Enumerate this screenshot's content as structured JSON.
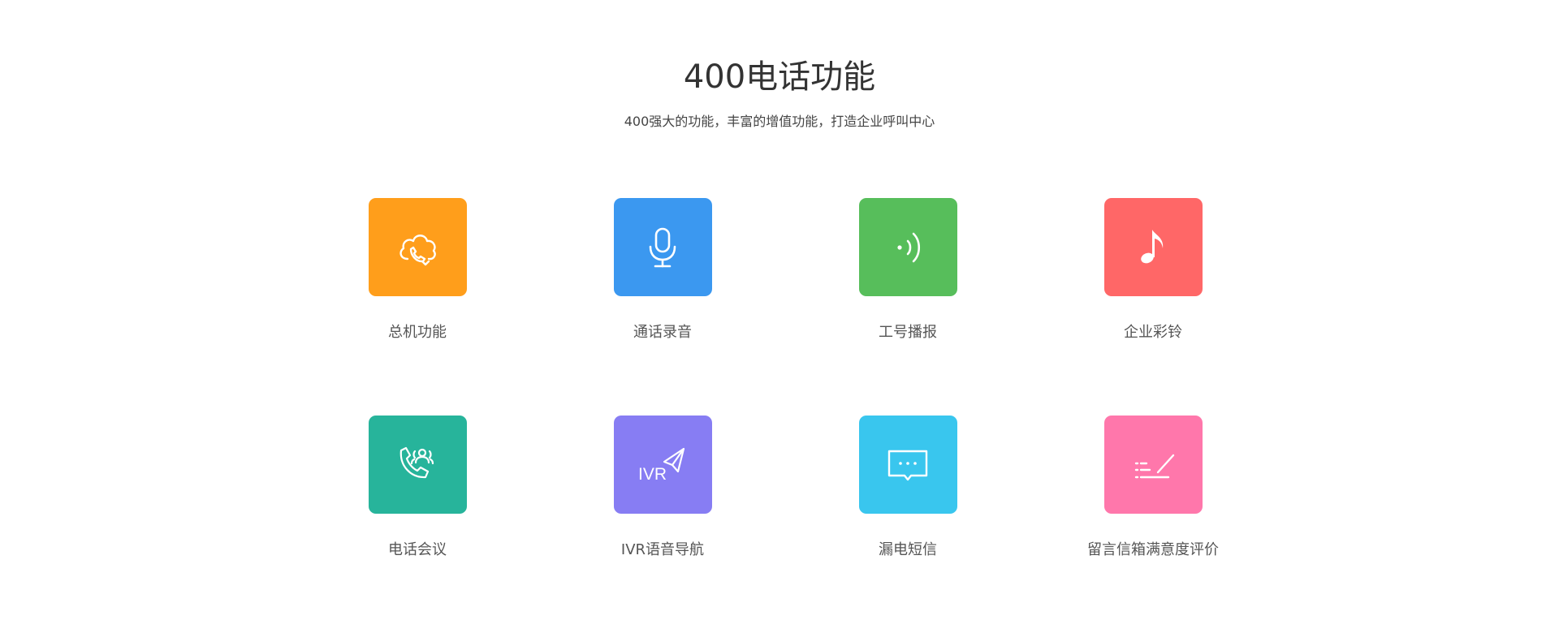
{
  "header": {
    "title": "400电话功能",
    "subtitle": "400强大的功能，丰富的增值功能，打造企业呼叫中心"
  },
  "features": [
    {
      "label": "总机功能",
      "color": "#FF9E1B",
      "icon": "cloud-phone-icon"
    },
    {
      "label": "通话录音",
      "color": "#3B98F0",
      "icon": "microphone-icon"
    },
    {
      "label": "工号播报",
      "color": "#57BE5B",
      "icon": "broadcast-icon"
    },
    {
      "label": "企业彩铃",
      "color": "#FF6767",
      "icon": "music-note-icon"
    },
    {
      "label": "电话会议",
      "color": "#27B49B",
      "icon": "phone-conference-icon"
    },
    {
      "label": "IVR语音导航",
      "color": "#877DF3",
      "icon": "ivr-navigation-icon",
      "icon_text": "IVR"
    },
    {
      "label": "漏电短信",
      "color": "#39C6EE",
      "icon": "message-bubble-icon"
    },
    {
      "label": "留言信箱满意度评价",
      "color": "#FF77AB",
      "icon": "rating-list-icon"
    }
  ]
}
